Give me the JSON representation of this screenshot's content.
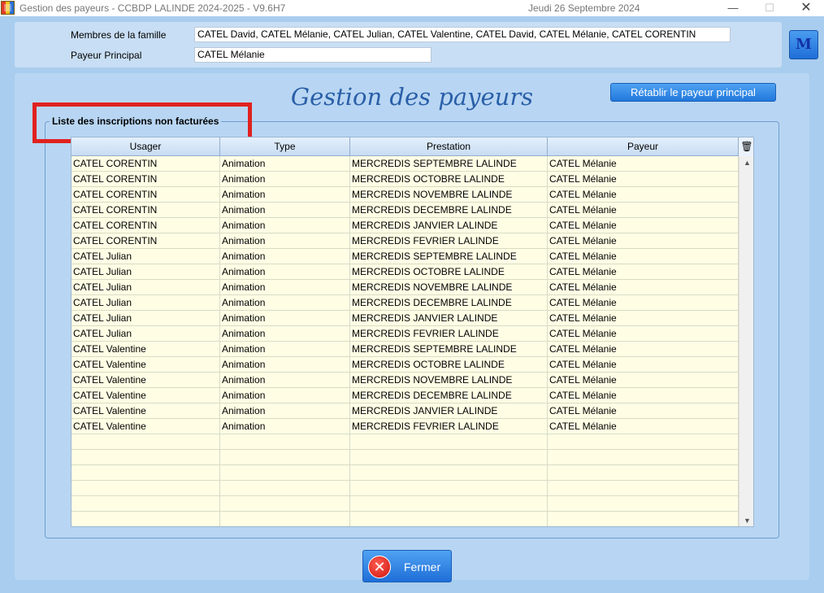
{
  "window": {
    "title": "Gestion des payeurs  -  CCBDP LALINDE 2024-2025  -  V9.6H7",
    "date": "Jeudi 26 Septembre 2024",
    "minimize_icon": "—",
    "maximize_icon": "☐",
    "close_icon": "✕"
  },
  "family": {
    "members_label": "Membres de la famille",
    "members_value": "CATEL David, CATEL Mélanie, CATEL Julian, CATEL Valentine, CATEL David, CATEL Mélanie, CATEL CORENTIN",
    "payer_label": "Payeur Principal",
    "payer_value": "CATEL Mélanie"
  },
  "m_button": "M",
  "heading": "Gestion des payeurs",
  "restore_button": "Rétablir le payeur principal",
  "group_title": "Liste des inscriptions non facturées",
  "table": {
    "columns": [
      "Usager",
      "Type",
      "Prestation",
      "Payeur"
    ],
    "corner_icon": "🗑",
    "rows": [
      [
        "CATEL CORENTIN",
        "Animation",
        "MERCREDIS SEPTEMBRE LALINDE",
        "CATEL Mélanie"
      ],
      [
        "CATEL CORENTIN",
        "Animation",
        "MERCREDIS OCTOBRE LALINDE",
        "CATEL Mélanie"
      ],
      [
        "CATEL CORENTIN",
        "Animation",
        "MERCREDIS NOVEMBRE LALINDE",
        "CATEL Mélanie"
      ],
      [
        "CATEL CORENTIN",
        "Animation",
        "MERCREDIS DECEMBRE LALINDE",
        "CATEL Mélanie"
      ],
      [
        "CATEL CORENTIN",
        "Animation",
        "MERCREDIS JANVIER LALINDE",
        "CATEL Mélanie"
      ],
      [
        "CATEL CORENTIN",
        "Animation",
        "MERCREDIS FEVRIER LALINDE",
        "CATEL Mélanie"
      ],
      [
        "CATEL Julian",
        "Animation",
        "MERCREDIS SEPTEMBRE LALINDE",
        "CATEL Mélanie"
      ],
      [
        "CATEL Julian",
        "Animation",
        "MERCREDIS OCTOBRE LALINDE",
        "CATEL Mélanie"
      ],
      [
        "CATEL Julian",
        "Animation",
        "MERCREDIS NOVEMBRE LALINDE",
        "CATEL Mélanie"
      ],
      [
        "CATEL Julian",
        "Animation",
        "MERCREDIS DECEMBRE LALINDE",
        "CATEL Mélanie"
      ],
      [
        "CATEL Julian",
        "Animation",
        "MERCREDIS JANVIER LALINDE",
        "CATEL Mélanie"
      ],
      [
        "CATEL Julian",
        "Animation",
        "MERCREDIS FEVRIER LALINDE",
        "CATEL Mélanie"
      ],
      [
        "CATEL Valentine",
        "Animation",
        "MERCREDIS SEPTEMBRE LALINDE",
        "CATEL Mélanie"
      ],
      [
        "CATEL Valentine",
        "Animation",
        "MERCREDIS OCTOBRE LALINDE",
        "CATEL Mélanie"
      ],
      [
        "CATEL Valentine",
        "Animation",
        "MERCREDIS NOVEMBRE LALINDE",
        "CATEL Mélanie"
      ],
      [
        "CATEL Valentine",
        "Animation",
        "MERCREDIS DECEMBRE LALINDE",
        "CATEL Mélanie"
      ],
      [
        "CATEL Valentine",
        "Animation",
        "MERCREDIS JANVIER LALINDE",
        "CATEL Mélanie"
      ],
      [
        "CATEL Valentine",
        "Animation",
        "MERCREDIS FEVRIER LALINDE",
        "CATEL Mélanie"
      ],
      [
        "",
        "",
        "",
        ""
      ],
      [
        "",
        "",
        "",
        ""
      ],
      [
        "",
        "",
        "",
        ""
      ],
      [
        "",
        "",
        "",
        ""
      ],
      [
        "",
        "",
        "",
        ""
      ],
      [
        "",
        "",
        "",
        ""
      ]
    ]
  },
  "close_button": {
    "label": "Fermer",
    "icon": "✕"
  },
  "colors": {
    "background": "#a9cdee",
    "heading": "#2a5fa8",
    "button": "#2178dc",
    "highlight": "#e0221f",
    "row_bg": "#fffee5"
  }
}
